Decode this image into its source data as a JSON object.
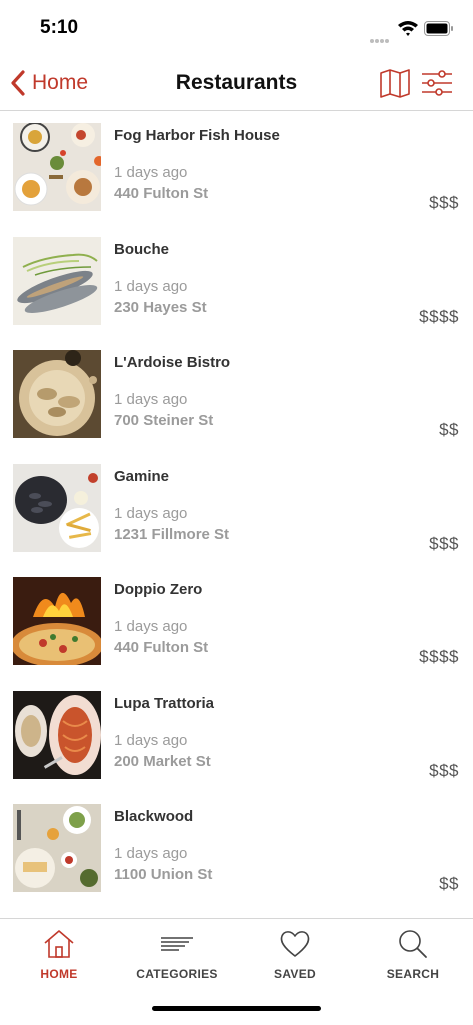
{
  "status_bar": {
    "time": "5:10"
  },
  "nav": {
    "back_label": "Home",
    "title": "Restaurants",
    "map_icon": "map-icon",
    "filter_icon": "sliders-icon",
    "accent_color": "#c0392b"
  },
  "restaurants": [
    {
      "name": "Fog Harbor Fish House",
      "time": "1 days ago",
      "address": "440 Fulton St",
      "price": "$$$"
    },
    {
      "name": "Bouche",
      "time": "1 days ago",
      "address": "230 Hayes St",
      "price": "$$$$"
    },
    {
      "name": "L'Ardoise Bistro",
      "time": "1 days ago",
      "address": "700 Steiner St",
      "price": "$$"
    },
    {
      "name": "Gamine",
      "time": "1 days ago",
      "address": "1231 Fillmore St",
      "price": "$$$"
    },
    {
      "name": "Doppio Zero",
      "time": "1 days ago",
      "address": "440 Fulton St",
      "price": "$$$$"
    },
    {
      "name": "Lupa Trattoria",
      "time": "1 days ago",
      "address": "200 Market St",
      "price": "$$$"
    },
    {
      "name": "Blackwood",
      "time": "1 days ago",
      "address": "1100 Union St",
      "price": "$$"
    }
  ],
  "tabs": [
    {
      "label": "HOME",
      "icon": "home-icon",
      "active": true
    },
    {
      "label": "CATEGORIES",
      "icon": "categories-icon",
      "active": false
    },
    {
      "label": "SAVED",
      "icon": "heart-icon",
      "active": false
    },
    {
      "label": "SEARCH",
      "icon": "search-icon",
      "active": false
    }
  ],
  "colors": {
    "active_tab": "#c0392b",
    "inactive_tab": "#444444"
  }
}
